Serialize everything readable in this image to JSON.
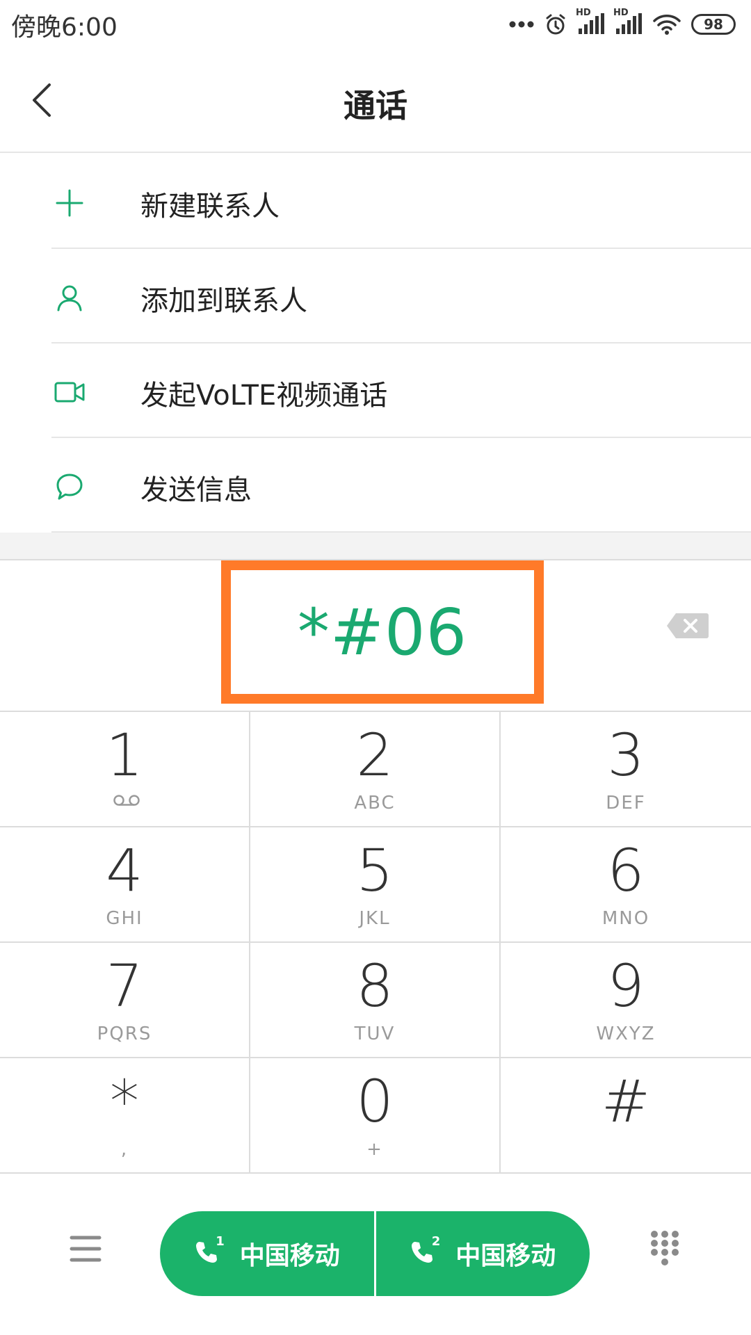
{
  "status_bar": {
    "time": "傍晚6:00",
    "battery": "98",
    "network_badges": [
      "HD",
      "HD"
    ]
  },
  "header": {
    "title": "通话"
  },
  "menu": {
    "items": [
      {
        "label": "新建联系人",
        "icon": "plus-icon"
      },
      {
        "label": "添加到联系人",
        "icon": "person-icon"
      },
      {
        "label": "发起VoLTE视频通话",
        "icon": "video-camera-icon"
      },
      {
        "label": "发送信息",
        "icon": "message-bubble-icon"
      }
    ]
  },
  "dialer": {
    "entered_number": "*#06"
  },
  "keypad": {
    "keys": [
      {
        "digit": "1",
        "letters": ""
      },
      {
        "digit": "2",
        "letters": "ABC"
      },
      {
        "digit": "3",
        "letters": "DEF"
      },
      {
        "digit": "4",
        "letters": "GHI"
      },
      {
        "digit": "5",
        "letters": "JKL"
      },
      {
        "digit": "6",
        "letters": "MNO"
      },
      {
        "digit": "7",
        "letters": "PQRS"
      },
      {
        "digit": "8",
        "letters": "TUV"
      },
      {
        "digit": "9",
        "letters": "WXYZ"
      },
      {
        "digit": "*",
        "letters": ","
      },
      {
        "digit": "0",
        "letters": "+"
      },
      {
        "digit": "#",
        "letters": ""
      }
    ]
  },
  "bottom_bar": {
    "sim1_label": "中国移动",
    "sim2_label": "中国移动",
    "sim1_index": "1",
    "sim2_index": "2"
  },
  "colors": {
    "accent_green": "#1bb36a",
    "number_green": "#1aa970",
    "highlight_orange": "#ff7a29"
  }
}
